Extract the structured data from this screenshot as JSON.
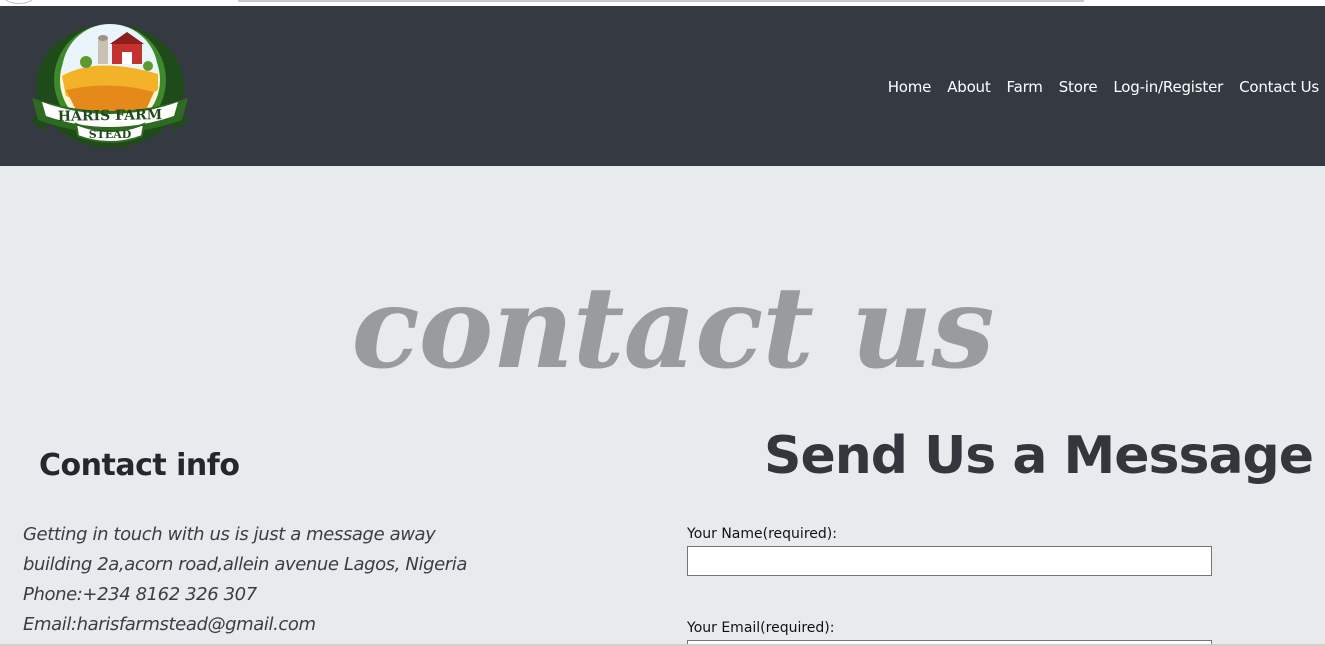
{
  "brand": {
    "logo_line1": "HARIS FARM",
    "logo_line2": "STEAD"
  },
  "nav": {
    "items": [
      {
        "label": "Home"
      },
      {
        "label": "About"
      },
      {
        "label": "Farm"
      },
      {
        "label": "Store"
      },
      {
        "label": "Log-in/Register"
      },
      {
        "label": "Contact Us"
      }
    ]
  },
  "hero": {
    "title": "contact us"
  },
  "contact_info": {
    "heading": "Contact info",
    "lines": [
      "Getting in touch with us is just a message away",
      "building 2a,acorn road,allein avenue Lagos, Nigeria",
      "Phone:+234 8162 326 307",
      "Email:harisfarmstead@gmail.com"
    ]
  },
  "form": {
    "heading": "Send Us a Message",
    "name_label": "Your Name(required):",
    "name_value": "",
    "email_label": "Your Email(required):",
    "email_value": ""
  },
  "colors": {
    "header_bg": "#353a42",
    "page_bg": "#e8ebee",
    "hero_text": "#9a9b9d",
    "logo_green": "#1f5a1e"
  }
}
